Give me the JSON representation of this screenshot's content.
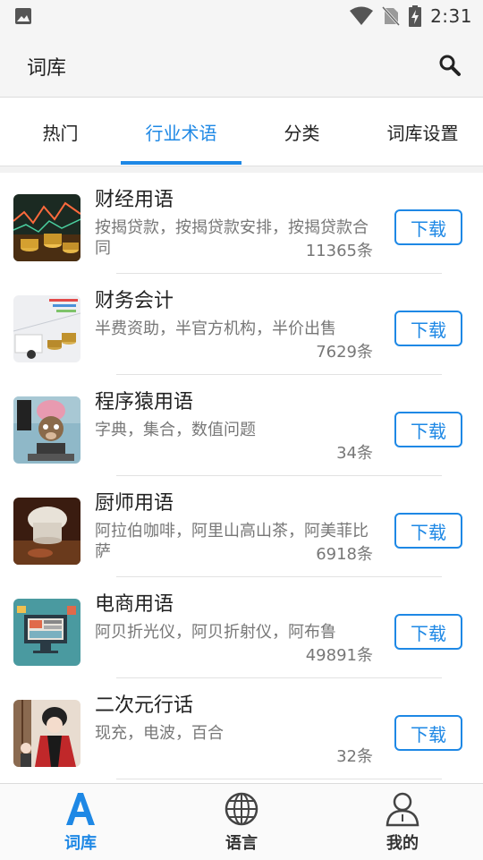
{
  "status_bar": {
    "time": "2:31",
    "icons": [
      "image-icon",
      "wifi-icon",
      "no-sim-icon",
      "battery-charging-icon"
    ]
  },
  "header": {
    "title": "词库",
    "search_icon": "search-icon"
  },
  "tabs": [
    {
      "label": "热门",
      "active": false
    },
    {
      "label": "行业术语",
      "active": true
    },
    {
      "label": "分类",
      "active": false
    },
    {
      "label": "词库设置",
      "active": false
    }
  ],
  "items": [
    {
      "title": "财经用语",
      "description": "按揭贷款，按揭贷款安排，按揭贷款合同",
      "count": "11365条",
      "button": "下载",
      "thumb": "finance-chart-coins"
    },
    {
      "title": "财务会计",
      "description": "半费资助，半官方机构，半价出售",
      "count": "7629条",
      "button": "下载",
      "thumb": "accounting-coins"
    },
    {
      "title": "程序猿用语",
      "description": "字典，集合，数值问题",
      "count": "34条",
      "button": "下载",
      "thumb": "programmer-monkey"
    },
    {
      "title": "厨师用语",
      "description": "阿拉伯咖啡，阿里山高山茶，阿美菲比萨",
      "count": "6918条",
      "button": "下载",
      "thumb": "chef-hat"
    },
    {
      "title": "电商用语",
      "description": "阿贝折光仪，阿贝折射仪，阿布鲁",
      "count": "49891条",
      "button": "下载",
      "thumb": "ecommerce-screen"
    },
    {
      "title": "二次元行话",
      "description": "现充，电波，百合",
      "count": "32条",
      "button": "下载",
      "thumb": "anime-character"
    }
  ],
  "bottom_nav": [
    {
      "label": "词库",
      "icon": "letter-a-icon",
      "active": true
    },
    {
      "label": "语言",
      "icon": "globe-icon",
      "active": false
    },
    {
      "label": "我的",
      "icon": "person-icon",
      "active": false
    }
  ],
  "colors": {
    "accent": "#1e88e5",
    "text": "#222222",
    "muted": "#777777"
  }
}
